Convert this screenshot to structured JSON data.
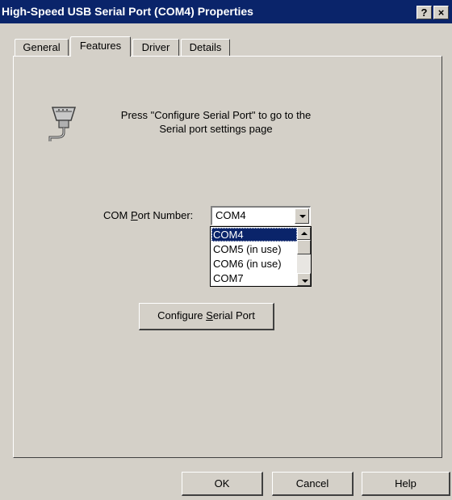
{
  "window": {
    "title": "High-Speed USB Serial Port (COM4) Properties",
    "help_button": "?",
    "close_button": "×"
  },
  "tabs": [
    {
      "label": "General",
      "active": false
    },
    {
      "label": "Features",
      "active": true
    },
    {
      "label": "Driver",
      "active": false
    },
    {
      "label": "Details",
      "active": false
    }
  ],
  "features": {
    "icon": "serial-port-connector-icon",
    "info_line1": "Press \"Configure Serial Port\" to go to the",
    "info_line2": "Serial port settings page",
    "com_label_pre": "COM ",
    "com_label_key": "P",
    "com_label_post": "ort Number:",
    "com_selected": "COM4",
    "com_options": [
      "COM4",
      "COM5 (in use)",
      "COM6 (in use)",
      "COM7"
    ],
    "configure_pre": "Configure ",
    "configure_key": "S",
    "configure_post": "erial Port"
  },
  "footer": {
    "ok": "OK",
    "cancel": "Cancel",
    "help": "Help"
  },
  "colors": {
    "titlebar": "#0a246a",
    "face": "#d4d0c8",
    "selection": "#0a246a"
  }
}
